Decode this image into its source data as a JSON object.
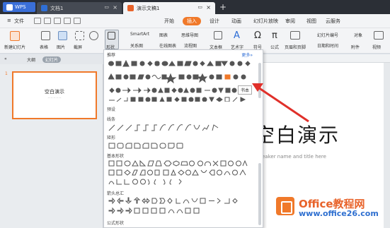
{
  "titlebar": {
    "app": "WPS",
    "tabs": [
      {
        "label": "文档1",
        "icon": "doc-icon"
      },
      {
        "label": "演示文稿1",
        "icon": "ppt-icon"
      }
    ]
  },
  "menubar": {
    "file": "文件",
    "items": [
      "开始",
      "插入",
      "设计",
      "动画",
      "幻灯片放映",
      "审阅",
      "视图",
      "云服务"
    ],
    "active": "插入"
  },
  "ribbon": {
    "new_slide": "新建幻灯片",
    "table": "表格",
    "picture": "图片",
    "screenshot": "截屏",
    "shapes": "形状",
    "smartart": "SmartArt",
    "chart": "图表",
    "online_flowchart": "思维导图",
    "relation": "关系图",
    "online_chart": "在线图表",
    "flowchart": "流程图",
    "textbox": "文本框",
    "wordart": "艺术字",
    "symbol": "符号",
    "formula": "公式",
    "header_footer": "页眉和页脚",
    "slide_number": "幻灯片编号",
    "datetime": "日期和时间",
    "object": "对象",
    "attachment": "附件",
    "video": "视频"
  },
  "leftpane": {
    "tab_outline": "大纲",
    "tab_slides": "幻灯片",
    "slide_number": "1",
    "thumb_title": "空白演示"
  },
  "slide": {
    "title": "空白演示",
    "subtitle": "eaker name and title here"
  },
  "dropdown": {
    "header": "推荐",
    "more": "更多»",
    "sections": [
      "预设",
      "线条",
      "矩形",
      "基本形状",
      "箭头总汇",
      "公式形状"
    ],
    "tooltip": "书本"
  },
  "watermark": {
    "line1": "Office教程网",
    "line2": "www.office26.com"
  },
  "colors": {
    "accent": "#f0792a",
    "titlebar": "#2b2f36",
    "annotation": "#e0302a"
  }
}
